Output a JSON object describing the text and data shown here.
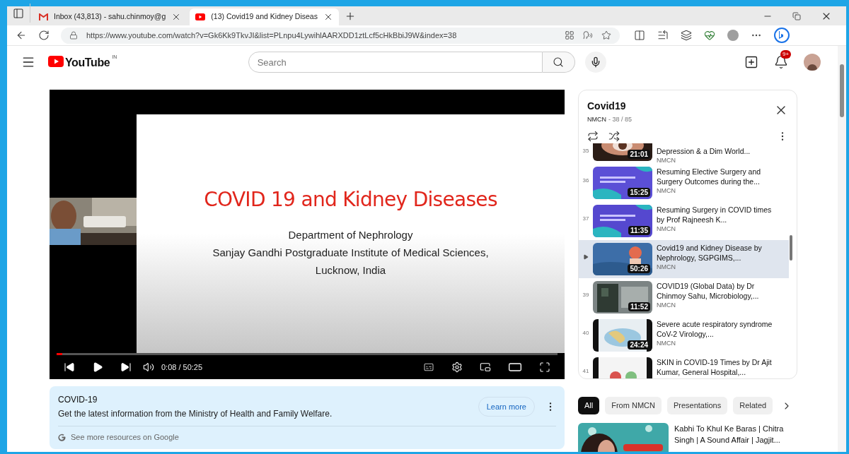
{
  "browser": {
    "tabs": [
      {
        "kind": "mail",
        "title": "Inbox (43,813) - sahu.chinmoy@g",
        "selected": false
      },
      {
        "kind": "video",
        "title": "(13) Covid19 and Kidney Diseas",
        "selected": true
      }
    ],
    "url": "https://www.youtube.com/watch?v=Gk6Kk9TkvJI&list=PLnpu4LywihlAARXDD1ztLcf5cHkBbiJ9W&index=38"
  },
  "header": {
    "logo": "YouTube",
    "country": "IN",
    "search": {
      "placeholder": "Search"
    },
    "notifications": "9+"
  },
  "video": {
    "slide": {
      "title": "COVID 19 and Kidney Diseases",
      "lines": [
        "Department of Nephrology",
        "Sanjay Gandhi Postgraduate Institute of Medical Sciences,",
        "Lucknow, India"
      ]
    },
    "level": 0.003,
    "time": "0:08 / 50:25"
  },
  "info_panel": {
    "title": "COVID-19",
    "text": "Get the latest information from the Ministry of Health and Family Welfare.",
    "button": "Learn more",
    "footer": "See more resources on Google"
  },
  "playlist": {
    "title": "Covid19",
    "channel": "NMCN",
    "position": "- 38 / 85",
    "items": [
      {
        "number": "35",
        "title": "Depression & a Dim World...",
        "channel": "NMCN",
        "duration": "21:01",
        "selected": false
      },
      {
        "number": "36",
        "title": "Resuming Elective Surgery and Surgery Outcomes during the...",
        "channel": "NMCN",
        "duration": "15:25",
        "selected": false
      },
      {
        "number": "37",
        "title": "Resuming Surgery in COVID times by Prof Rajneesh K...",
        "channel": "NMCN",
        "duration": "11:35",
        "selected": false
      },
      {
        "title": "Covid19 and Kidney Disease by Nephrology, SGPGIMS,...",
        "channel": "NMCN",
        "duration": "50:26",
        "selected": true
      },
      {
        "number": "39",
        "title": "COVID19 (Global Data) by Dr Chinmoy Sahu, Microbiology,...",
        "channel": "NMCN",
        "duration": "11:52",
        "selected": false
      },
      {
        "number": "40",
        "title": "Severe acute respiratory syndrome CoV-2 Virology,...",
        "channel": "NMCN",
        "duration": "24:24",
        "selected": false
      },
      {
        "number": "41",
        "title": "SKIN in COVID-19 Times by Dr Ajit Kumar, General Hospital,...",
        "selected": false
      }
    ]
  },
  "chips": [
    {
      "label": "All",
      "selected": true
    },
    {
      "label": "From NMCN",
      "selected": false
    },
    {
      "label": "Presentations",
      "selected": false
    },
    {
      "label": "Related",
      "selected": false
    }
  ],
  "recommendations": [
    {
      "title": "Kabhi To Khul Ke Baras | Chitra Singh | A Sound Affair | Jagjit..."
    }
  ]
}
